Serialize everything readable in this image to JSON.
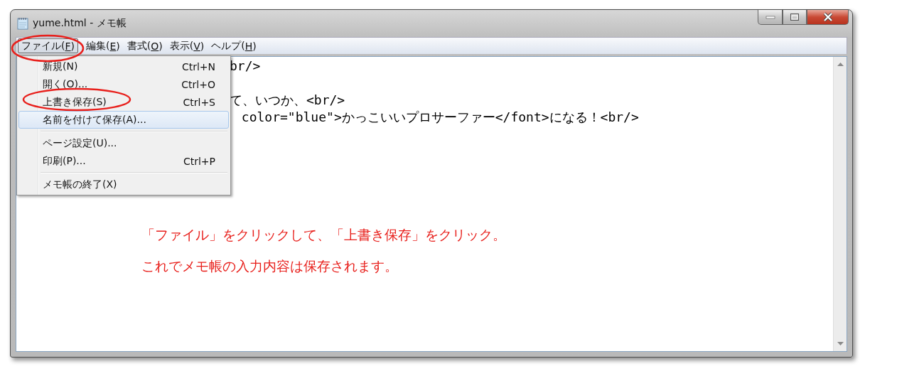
{
  "window": {
    "title": "yume.html - メモ帳"
  },
  "menu_bar": [
    {
      "before": "ファイル(",
      "key": "F",
      "after": ")",
      "selected": true
    },
    {
      "before": "編集(",
      "key": "E",
      "after": ")",
      "selected": false
    },
    {
      "before": "書式(",
      "key": "O",
      "after": ")",
      "selected": false
    },
    {
      "before": "表示(",
      "key": "V",
      "after": ")",
      "selected": false
    },
    {
      "before": "ヘルプ(",
      "key": "H",
      "after": ")",
      "selected": false
    }
  ],
  "file_menu": [
    {
      "kind": "item",
      "label": "新規(N)",
      "shortcut": "Ctrl+N",
      "selected": false
    },
    {
      "kind": "item",
      "label": "開く(O)...",
      "shortcut": "Ctrl+O",
      "selected": false
    },
    {
      "kind": "item",
      "label": "上書き保存(S)",
      "shortcut": "Ctrl+S",
      "selected": false
    },
    {
      "kind": "item",
      "label": "名前を付けて保存(A)...",
      "selected": true
    },
    {
      "kind": "separator"
    },
    {
      "kind": "item",
      "label": "ページ設定(U)...",
      "selected": false
    },
    {
      "kind": "item",
      "label": "印刷(P)...",
      "shortcut": "Ctrl+P",
      "selected": false
    },
    {
      "kind": "separator"
    },
    {
      "kind": "item",
      "label": "メモ帳の終了(X)",
      "selected": false
    }
  ],
  "editor": {
    "lines": [
      "br/>",
      "て、いつか、<br/>",
      " color=\"blue\">かっこいいプロサーファー</font>になる！<br/>"
    ]
  },
  "annotation": {
    "lines": [
      "「ファイル」をクリックして、「上書き保存」をクリック。",
      "これでメモ帳の入力内容は保存されます。"
    ]
  }
}
